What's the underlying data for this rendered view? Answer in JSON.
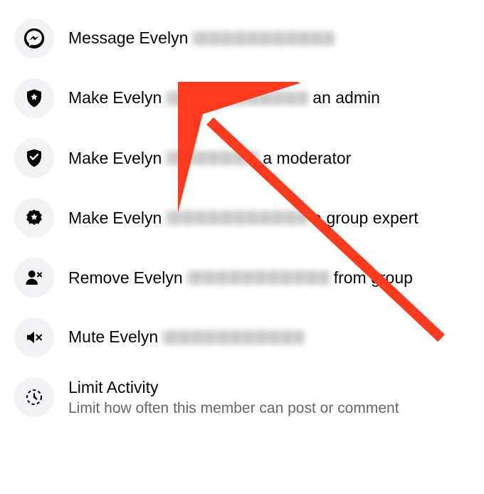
{
  "member_first_name": "Evelyn",
  "menu": {
    "message": {
      "prefix": "Message",
      "suffix": ""
    },
    "admin": {
      "prefix": "Make",
      "suffix": "an admin"
    },
    "moderator": {
      "prefix": "Make",
      "suffix": "a moderator"
    },
    "expert": {
      "prefix": "Make",
      "suffix": "a group expert"
    },
    "remove": {
      "prefix": "Remove",
      "suffix": "from group"
    },
    "mute": {
      "prefix": "Mute",
      "suffix": ""
    },
    "limit": {
      "title": "Limit Activity",
      "subtitle": "Limit how often this member can post or comment"
    }
  }
}
